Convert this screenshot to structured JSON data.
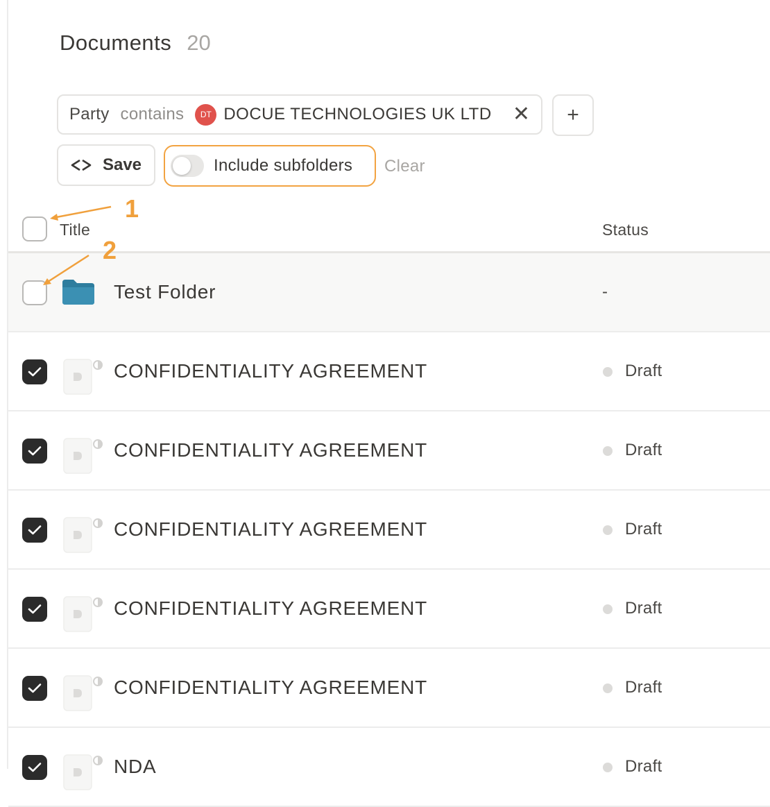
{
  "header": {
    "title": "Documents",
    "count": "20"
  },
  "filter": {
    "field": "Party",
    "operator": "contains",
    "avatar_initials": "DT",
    "value": "DOCUE TECHNOLOGIES UK LTD",
    "remove_glyph": "✕"
  },
  "add_filter_glyph": "+",
  "actions": {
    "save_label": "Save",
    "include_subfolders_label": "Include subfolders",
    "include_subfolders_on": false,
    "clear_label": "Clear"
  },
  "table": {
    "columns": {
      "title": "Title",
      "status": "Status"
    },
    "folder_row": {
      "title": "Test Folder",
      "status": "-"
    },
    "rows": [
      {
        "title": "CONFIDENTIALITY AGREEMENT",
        "status": "Draft",
        "checked": true
      },
      {
        "title": "CONFIDENTIALITY AGREEMENT",
        "status": "Draft",
        "checked": true
      },
      {
        "title": "CONFIDENTIALITY AGREEMENT",
        "status": "Draft",
        "checked": true
      },
      {
        "title": "CONFIDENTIALITY AGREEMENT",
        "status": "Draft",
        "checked": true
      },
      {
        "title": "CONFIDENTIALITY AGREEMENT",
        "status": "Draft",
        "checked": true
      },
      {
        "title": "NDA",
        "status": "Draft",
        "checked": true
      }
    ]
  },
  "annotations": {
    "marker_1": "1",
    "marker_2": "2"
  },
  "colors": {
    "accent_orange": "#f2a341",
    "avatar_red": "#e0524c",
    "folder_teal": "#2e7d9e",
    "checkbox_dark": "#2b2b2b"
  },
  "icons": {
    "save": "save-view-icon",
    "folder": "folder-icon",
    "document": "document-icon",
    "check": "checkmark-icon"
  }
}
